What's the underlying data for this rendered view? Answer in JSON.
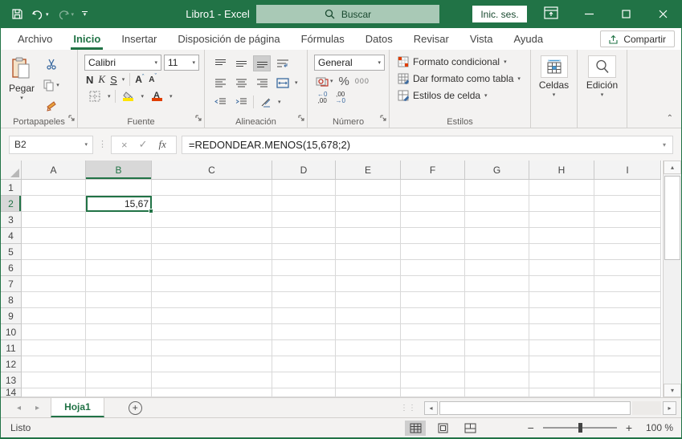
{
  "colors": {
    "accent": "#217346",
    "title_bg": "#217346",
    "search_bg": "#a9c9b6",
    "ribbon_bg": "#f3f2f1",
    "selection": "#217346",
    "fill_yellow": "#ffe400",
    "font_red": "#e03e00"
  },
  "titlebar": {
    "title": "Libro1 - Excel",
    "search_label": "Buscar",
    "sign_in_label": "Inic. ses."
  },
  "tabs": [
    {
      "label": "Archivo",
      "active": false
    },
    {
      "label": "Inicio",
      "active": true
    },
    {
      "label": "Insertar",
      "active": false
    },
    {
      "label": "Disposición de página",
      "active": false
    },
    {
      "label": "Fórmulas",
      "active": false
    },
    {
      "label": "Datos",
      "active": false
    },
    {
      "label": "Revisar",
      "active": false
    },
    {
      "label": "Vista",
      "active": false
    },
    {
      "label": "Ayuda",
      "active": false
    }
  ],
  "share_label": "Compartir",
  "ribbon": {
    "clipboard": {
      "label": "Portapapeles",
      "paste_label": "Pegar"
    },
    "font": {
      "label": "Fuente",
      "font_name": "Calibri",
      "font_size": "11",
      "bold": "N",
      "italic": "K",
      "underline": "S",
      "grow_font": "A",
      "shrink_font": "A"
    },
    "alignment": {
      "label": "Alineación"
    },
    "number": {
      "label": "Número",
      "format_value": "General",
      "percent": "%",
      "thousands": "000",
      "inc_dec_top": "←0",
      "inc_dec_bottom": ",00",
      "dec_dec_top": ",00",
      "dec_dec_bottom": "→0"
    },
    "styles": {
      "label": "Estilos",
      "items": [
        "Formato condicional",
        "Dar formato como tabla",
        "Estilos de celda"
      ]
    },
    "cells": {
      "label": "Celdas"
    },
    "editing": {
      "label": "Edición"
    }
  },
  "formula_bar": {
    "name_box_value": "B2",
    "cancel": "×",
    "enter": "✓",
    "fx_label": "fx",
    "formula": "=REDONDEAR.MENOS(15,678;2)"
  },
  "grid": {
    "columns": [
      "A",
      "B",
      "C",
      "D",
      "E",
      "F",
      "G",
      "H",
      "I"
    ],
    "visible_rows": 14,
    "selected_column": "B",
    "selected_row": "2",
    "cells": [
      {
        "col": "B",
        "row": 2,
        "value": "15,67"
      }
    ]
  },
  "sheet_bar": {
    "tabs": [
      {
        "name": "Hoja1",
        "active": true
      }
    ]
  },
  "status_bar": {
    "mode": "Listo",
    "zoom": "100 %"
  }
}
